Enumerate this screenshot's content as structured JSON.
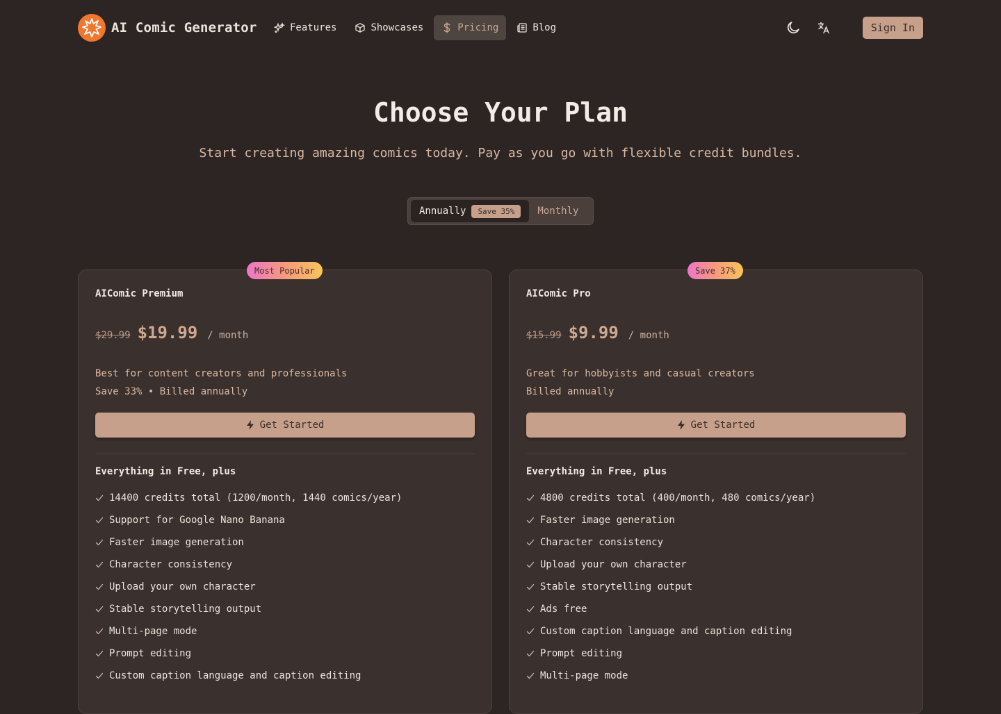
{
  "nav": {
    "brand": "AI Comic Generator",
    "links": [
      {
        "label": "Features"
      },
      {
        "label": "Showcases"
      },
      {
        "label": "Pricing"
      },
      {
        "label": "Blog"
      }
    ],
    "sign_in": "Sign In",
    "theme_icon": "moon-icon",
    "language_icon": "translate-icon"
  },
  "hero": {
    "title": "Choose Your Plan",
    "subtitle": "Start creating amazing comics today. Pay as you go with flexible credit bundles."
  },
  "billing_toggle": {
    "annually": "Annually",
    "save_badge": "Save 35%",
    "monthly": "Monthly",
    "selected": "Annually"
  },
  "plans": [
    {
      "badge": "Most Popular",
      "name": "AIComic Premium",
      "old_price": "$29.99",
      "price": "$19.99",
      "unit": "/ month",
      "description": "Best for content creators and professionals",
      "billing_note": "Save 33% • Billed annually",
      "cta": "Get Started",
      "features_heading": "Everything in Free, plus",
      "features": [
        "14400 credits total (1200/month, 1440 comics/year)",
        "Support for Google Nano Banana",
        "Faster image generation",
        "Character consistency",
        "Upload your own character",
        "Stable storytelling output",
        "Multi-page mode",
        "Prompt editing",
        "Custom caption language and caption editing"
      ]
    },
    {
      "badge": "Save 37%",
      "name": "AIComic Pro",
      "old_price": "$15.99",
      "price": "$9.99",
      "unit": "/ month",
      "description": "Great for hobbyists and casual creators",
      "billing_note": "Billed annually",
      "cta": "Get Started",
      "features_heading": "Everything in Free, plus",
      "features": [
        "4800 credits total (400/month, 480 comics/year)",
        "Faster image generation",
        "Character consistency",
        "Upload your own character",
        "Stable storytelling output",
        "Ads free",
        "Custom caption language and caption editing",
        "Prompt editing",
        "Multi-page mode"
      ]
    }
  ],
  "colors": {
    "background": "#2d2523",
    "card": "#3a302d",
    "accent": "#c6a08b",
    "brand_orange": "#f0772e",
    "price": "#cfa98f"
  }
}
